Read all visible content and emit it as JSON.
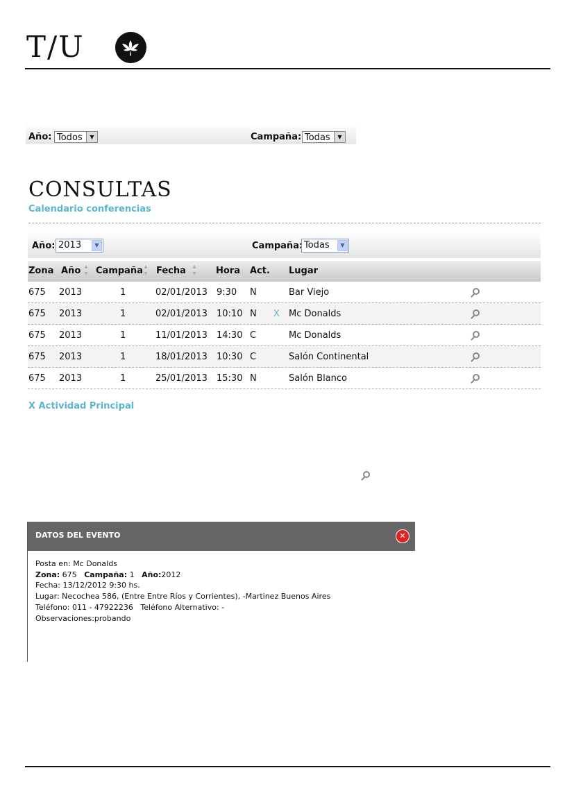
{
  "logo": {
    "text": "T/U"
  },
  "top_filter": {
    "year_label": "Año:",
    "year_value": "Todos",
    "campaign_label": "Campaña:",
    "campaign_value": "Todas"
  },
  "page": {
    "title": "CONSULTAS",
    "subtitle": "Calendario conferencias"
  },
  "table_filter": {
    "year_label": "Año:",
    "year_value": "2013",
    "campaign_label": "Campaña:",
    "campaign_value": "Todas"
  },
  "table": {
    "headers": {
      "zona": "Zona",
      "anio": "Año",
      "campana": "Campaña",
      "fecha": "Fecha",
      "hora": "Hora",
      "act": "Act.",
      "lugar": "Lugar"
    },
    "rows": [
      {
        "zona": "675",
        "anio": "2013",
        "campana": "1",
        "fecha": "02/01/2013",
        "hora": "9:30",
        "act": "N",
        "principal": "",
        "lugar": "Bar Viejo"
      },
      {
        "zona": "675",
        "anio": "2013",
        "campana": "1",
        "fecha": "02/01/2013",
        "hora": "10:10",
        "act": "N",
        "principal": "X",
        "lugar": "Mc Donalds"
      },
      {
        "zona": "675",
        "anio": "2013",
        "campana": "1",
        "fecha": "11/01/2013",
        "hora": "14:30",
        "act": "C",
        "principal": "",
        "lugar": "Mc Donalds"
      },
      {
        "zona": "675",
        "anio": "2013",
        "campana": "1",
        "fecha": "18/01/2013",
        "hora": "10:30",
        "act": "C",
        "principal": "",
        "lugar": "Salón Continental"
      },
      {
        "zona": "675",
        "anio": "2013",
        "campana": "1",
        "fecha": "25/01/2013",
        "hora": "15:30",
        "act": "N",
        "principal": "",
        "lugar": "Salón Blanco"
      }
    ]
  },
  "footnote": "X Actividad Principal",
  "event_panel": {
    "title": "DATOS DEL EVENTO",
    "posta_line": "Posta en: Mc Donalds",
    "zona_label": "Zona:",
    "zona_value": " 675",
    "campana_label": "Campaña:",
    "campana_value": " 1",
    "anio_label": "Año:",
    "anio_value": "2012",
    "fecha_line": "Fecha: 13/12/2012 9:30 hs.",
    "lugar_line": "Lugar: Necochea 586, (Entre Entre Ríos y Corrientes), -Martinez Buenos Aires",
    "telefono_line": "Teléfono: 011 - 47922236   Teléfono Alternativo: -",
    "observaciones_line": "Observaciones:probando"
  },
  "colors": {
    "accent": "#5ab6cc",
    "panel_header": "#666666",
    "close": "#dd2222"
  }
}
